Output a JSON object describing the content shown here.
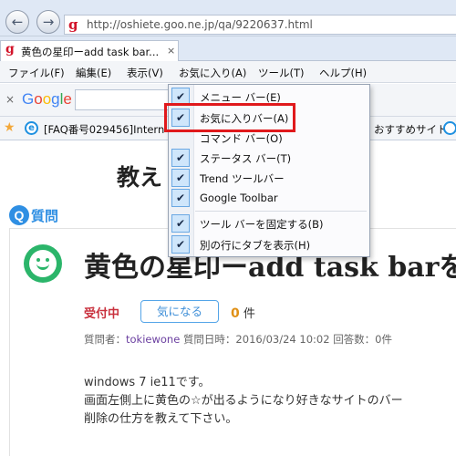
{
  "browser": {
    "url": "http://oshiete.goo.ne.jp/qa/9220637.html",
    "url_favicon": "g",
    "tab_title": "黄色の星印ーadd task bar...",
    "tab_favicon": "g",
    "tab_close": "×",
    "back_glyph": "←",
    "forward_glyph": "→"
  },
  "menubar": {
    "items": [
      "ファイル(F)",
      "編集(E)",
      "表示(V)",
      "お気に入り(A)",
      "ツール(T)",
      "ヘルプ(H)"
    ]
  },
  "google_toolbar": {
    "close_glyph": "×",
    "logo": [
      "G",
      "o",
      "o",
      "g",
      "l",
      "e"
    ]
  },
  "favorites_bar": {
    "star_glyph": "★",
    "ie_glyph": "e",
    "link_text": "[FAQ番号029456]Intern",
    "suggested_sites": "おすすめサイト ▾"
  },
  "context_menu": {
    "items": [
      {
        "label": "メニュー バー(E)",
        "checked": true
      },
      {
        "label": "お気に入りバー(A)",
        "checked": true
      },
      {
        "label": "コマンド バー(O)",
        "checked": false
      },
      {
        "label": "ステータス バー(T)",
        "checked": true
      },
      {
        "label": "Trend ツールバー",
        "checked": true
      },
      {
        "label": "Google Toolbar",
        "checked": true
      },
      {
        "label": "ツール バーを固定する(B)",
        "checked": true
      },
      {
        "label": "別の行にタブを表示(H)",
        "checked": true
      }
    ],
    "check_glyph": "✔",
    "highlight_color": "#e0191c"
  },
  "page": {
    "site_title": "教え",
    "section_badge": "Q",
    "section_label": "質問",
    "question_title": "黄色の星印ーadd task barを削",
    "status": "受付中",
    "follow_button": "気になる",
    "count_value": "0",
    "count_unit": "件",
    "meta_prefix": "質問者：",
    "meta_user": "tokiewone",
    "meta_date": "質問日時：2016/03/24 10:02",
    "meta_answers": "回答数：0件",
    "body_lines": [
      "windows 7 ie11です。",
      "画面左側上に黄色の☆が出るようになり好きなサイトのバー",
      "削除の仕方を教えて下さい。"
    ]
  },
  "colors": {
    "accent_blue": "#2f8fe3",
    "status_red": "#c9303d",
    "count_orange": "#e09016",
    "smiley_green": "#2bb56a"
  }
}
